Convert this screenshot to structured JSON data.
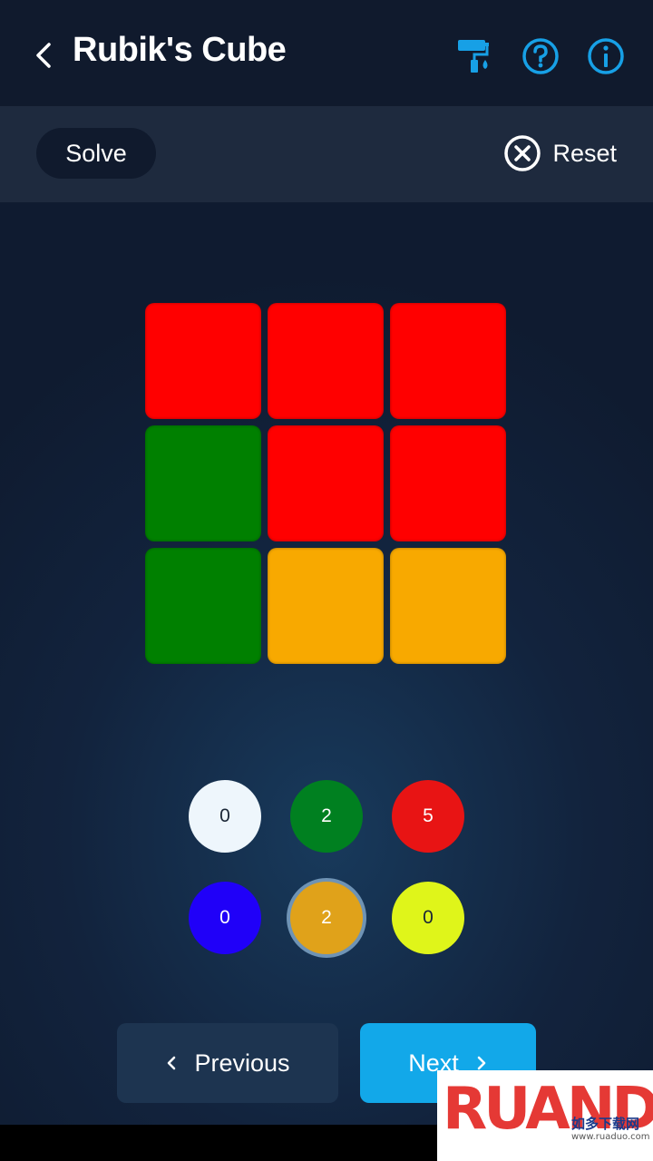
{
  "header": {
    "title": "Rubik's Cube",
    "icons": [
      "back-arrow-icon",
      "paint-roller-icon",
      "help-icon",
      "info-icon"
    ],
    "accent": "#17a0e6"
  },
  "toolbar": {
    "solve_label": "Solve",
    "reset_label": "Reset"
  },
  "face": {
    "cells": [
      "#ff0000",
      "#ff0000",
      "#ff0000",
      "#008000",
      "#ff0000",
      "#ff0000",
      "#008000",
      "#f8a900",
      "#f8a900"
    ]
  },
  "counters": [
    {
      "value": "0",
      "color": "#eef6fc",
      "text_color": "#1a2636"
    },
    {
      "value": "2",
      "color": "#008020",
      "text_color": "#ffffff"
    },
    {
      "value": "5",
      "color": "#e81414",
      "text_color": "#ffffff"
    },
    {
      "value": "0",
      "color": "#2000f8",
      "text_color": "#ffffff"
    },
    {
      "value": "2",
      "color": "#e0a21a",
      "text_color": "#ffffff",
      "selected": true
    },
    {
      "value": "0",
      "color": "#dff51a",
      "text_color": "#1a2636"
    }
  ],
  "navigation": {
    "previous_label": "Previous",
    "next_label": "Next"
  },
  "watermark": {
    "brand": "RUANDADUO",
    "cn_text": "如多下载网",
    "url": "www.ruaduo.com"
  }
}
